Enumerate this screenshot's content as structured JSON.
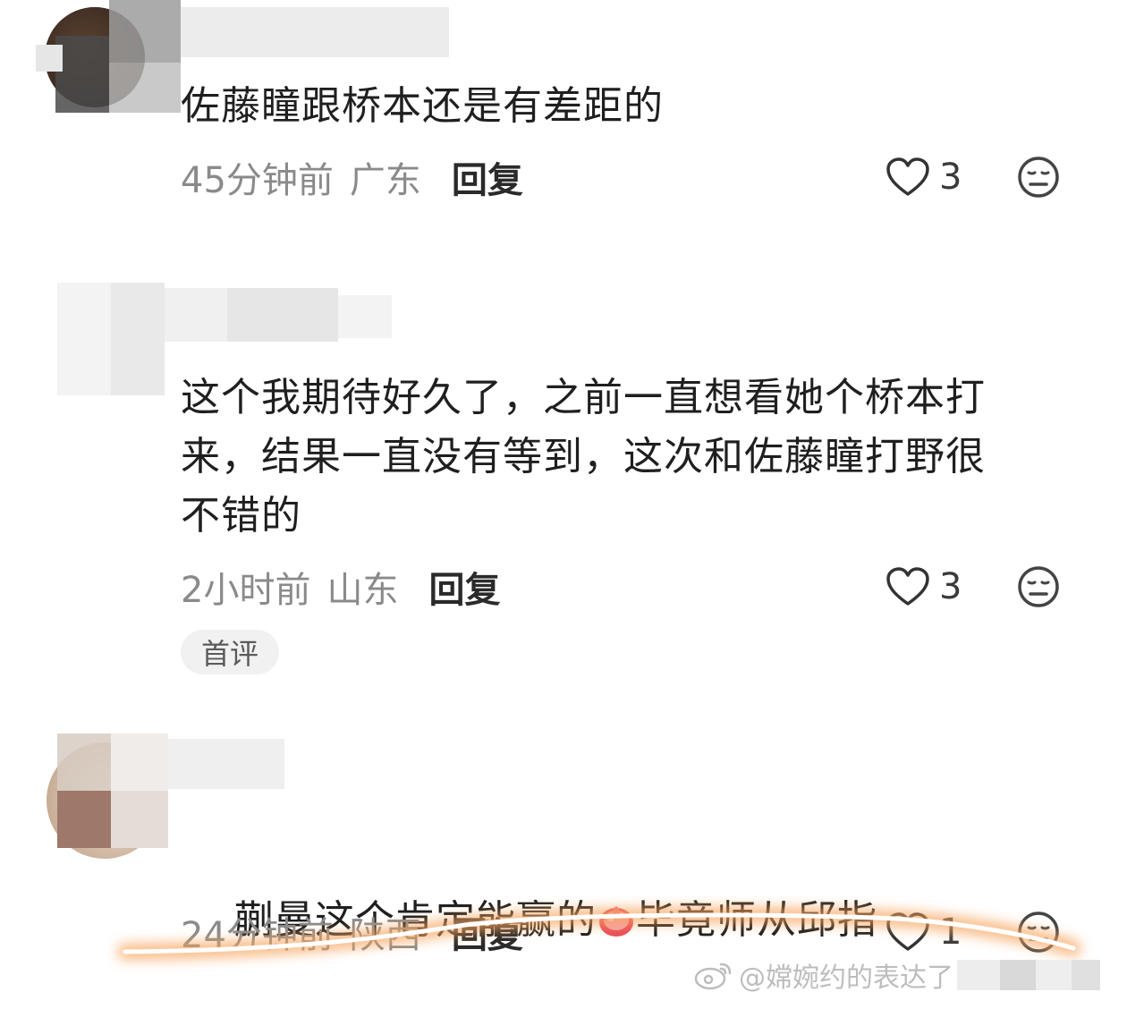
{
  "comments": [
    {
      "text": "佐藤瞳跟桥本还是有差距的",
      "time": "45分钟前",
      "region": "广东",
      "reply_label": "回复",
      "likes": "3",
      "badge": ""
    },
    {
      "text": "这个我期待好久了，之前一直想看她个桥本打\n来，结果一直没有等到，这次和佐藤瞳打野很\n不错的",
      "time": "2小时前",
      "region": "山东",
      "reply_label": "回复",
      "likes": "3",
      "badge": "首评"
    },
    {
      "text_before": "蒯曼这个肯定能赢的",
      "text_after": "毕竟师从邱指",
      "time": "24分钟前",
      "region": "陕西",
      "reply_label": "回复",
      "likes": "1",
      "badge": ""
    }
  ],
  "watermark": "@嫦婉约的表达了",
  "icons": {
    "like": "heart-outline-icon",
    "dislike": "meh-face-icon",
    "emoji": "fist-emoji-icon",
    "weibo": "weibo-logo-icon"
  },
  "colors": {
    "highlight": "#f7a25a",
    "meta_gray": "#8a8a8a"
  }
}
